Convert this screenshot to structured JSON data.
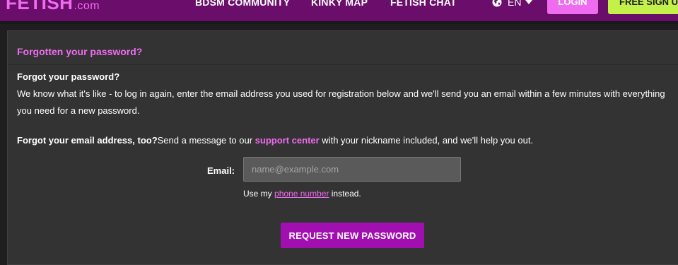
{
  "header": {
    "logo_main": "FETISH",
    "logo_suffix": ".com",
    "nav": [
      {
        "label": "BDSM COMMUNITY"
      },
      {
        "label": "KINKY MAP"
      },
      {
        "label": "FETISH CHAT"
      }
    ],
    "language": "EN",
    "login_label": "LOGIN",
    "signup_label": "FREE SIGN UP",
    "colors": {
      "bar": "#6b0e6b",
      "login": "#ef6bef",
      "signup": "#c4f04a"
    }
  },
  "main": {
    "title": "Forgotten your password?",
    "intro_heading": "Forgot your password?",
    "intro_text": "We know what it's like - to log in again, enter the email address you used for registration below and we'll send you an email within a few minutes with everything you need for a new password.",
    "email_help_bold": "Forgot your email address, too?",
    "email_help_before": "Send a message to our ",
    "support_link": "support center",
    "email_help_after": " with your nickname included, and we'll help you out.",
    "email_label": "Email:",
    "email_placeholder": "name@example.com",
    "email_value": "",
    "phone_before": "Use my ",
    "phone_link": "phone number",
    "phone_after": " instead.",
    "submit_label": "REQUEST NEW PASSWORD",
    "colors": {
      "accent": "#ef6bef",
      "button": "#a10fb0",
      "panel": "#333333"
    }
  }
}
